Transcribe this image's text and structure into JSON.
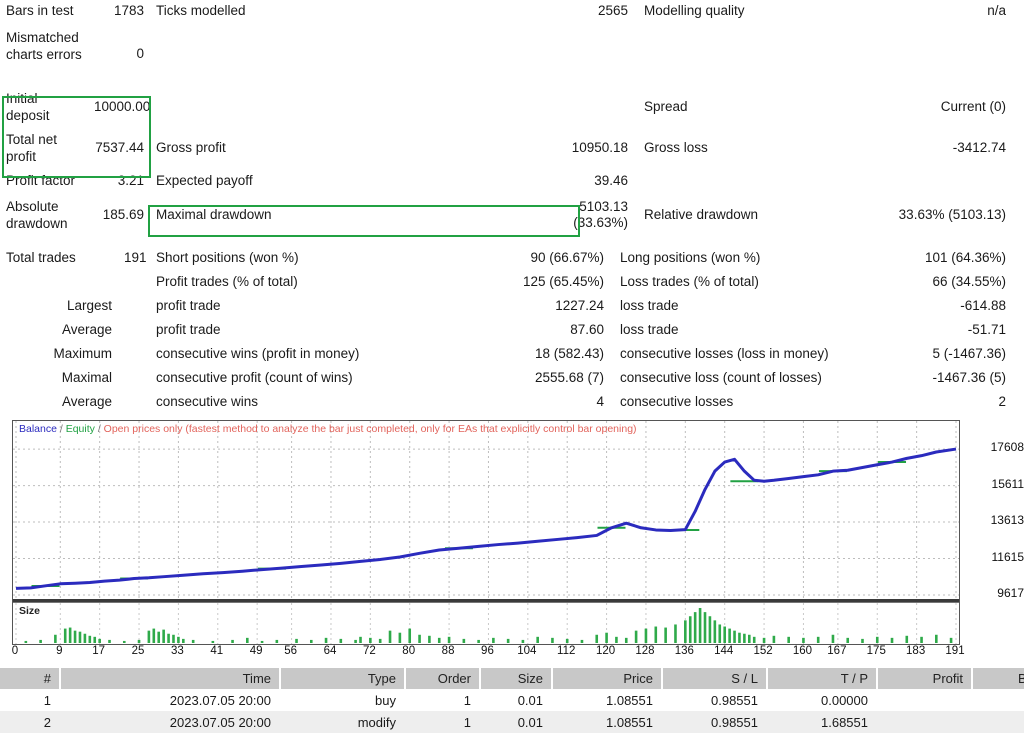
{
  "summary": {
    "rows": [
      {
        "l1": "Bars in test",
        "v1": "1783",
        "l2": "Ticks modelled",
        "v2": "2565",
        "l3": "Modelling quality",
        "v3": "n/a"
      },
      {
        "l1": "Mismatched charts errors",
        "v1": "0",
        "l2": "",
        "v2": "",
        "l3": "",
        "v3": ""
      },
      {
        "l1": "Initial deposit",
        "v1": "10000.00",
        "l2": "",
        "v2": "",
        "l3": "Spread",
        "v3": "Current (0)"
      },
      {
        "l1": "Total net profit",
        "v1": "7537.44",
        "l2": "Gross profit",
        "v2": "10950.18",
        "l3": "Gross loss",
        "v3": "-3412.74"
      },
      {
        "l1": "Profit factor",
        "v1": "3.21",
        "l2": "Expected payoff",
        "v2": "39.46",
        "l3": "",
        "v3": ""
      },
      {
        "l1": "Absolute drawdown",
        "v1": "185.69",
        "l2": "Maximal drawdown",
        "v2": "5103.13 (33.63%)",
        "l3": "Relative drawdown",
        "v3": "33.63% (5103.13)"
      }
    ],
    "trade_rows": [
      {
        "l1": "Total trades",
        "v1": "191",
        "l2": "Short positions (won %)",
        "v2": "90 (66.67%)",
        "l3": "Long positions (won %)",
        "v3": "101 (64.36%)"
      },
      {
        "l1": "",
        "v1": "",
        "l2": "Profit trades (% of total)",
        "v2": "125 (65.45%)",
        "l3": "Loss trades (% of total)",
        "v3": "66 (34.55%)"
      },
      {
        "l1": "Largest",
        "v1": "",
        "l2": "profit trade",
        "v2": "1227.24",
        "l3": "loss trade",
        "v3": "-614.88"
      },
      {
        "l1": "Average",
        "v1": "",
        "l2": "profit trade",
        "v2": "87.60",
        "l3": "loss trade",
        "v3": "-51.71"
      },
      {
        "l1": "Maximum",
        "v1": "",
        "l2": "consecutive wins (profit in money)",
        "v2": "18 (582.43)",
        "l3": "consecutive losses (loss in money)",
        "v3": "5 (-1467.36)"
      },
      {
        "l1": "Maximal",
        "v1": "",
        "l2": "consecutive profit (count of wins)",
        "v2": "2555.68 (7)",
        "l3": "consecutive loss (count of losses)",
        "v3": "-1467.36 (5)"
      },
      {
        "l1": "Average",
        "v1": "",
        "l2": "consecutive wins",
        "v2": "4",
        "l3": "consecutive losses",
        "v3": "2"
      }
    ]
  },
  "highlight_color": "#21a143",
  "chart_data": {
    "type": "line",
    "title": "",
    "legend": {
      "balance": "Balance",
      "separator": "/",
      "equity": "Equity",
      "note": "Open prices only (fastest method to analyze the bar just completed, only for EAs that explicitly control bar opening)",
      "position": "top-left"
    },
    "colors": {
      "balance": "#2b2bbe",
      "equity": "#21a143",
      "note": "#e2645c",
      "size_bars": "#2faa4a"
    },
    "xlabel": "",
    "ylabel": "",
    "ylim": [
      9617,
      18600
    ],
    "yticks": [
      17608,
      15611,
      13613,
      11615,
      9617
    ],
    "xticks": [
      0,
      9,
      17,
      25,
      33,
      41,
      49,
      56,
      64,
      72,
      80,
      88,
      96,
      104,
      112,
      120,
      128,
      136,
      144,
      152,
      160,
      167,
      175,
      183,
      191
    ],
    "grid": true,
    "series": [
      {
        "name": "Balance",
        "x": [
          0,
          3,
          6,
          9,
          12,
          15,
          18,
          21,
          24,
          27,
          30,
          34,
          38,
          42,
          46,
          50,
          54,
          58,
          62,
          66,
          70,
          74,
          78,
          82,
          86,
          90,
          94,
          98,
          102,
          106,
          110,
          114,
          118,
          121,
          124,
          127,
          130,
          133,
          136,
          138,
          140,
          142,
          144,
          146,
          148,
          150,
          152,
          154,
          157,
          160,
          163,
          166,
          169,
          172,
          175,
          178,
          181,
          184,
          187,
          191
        ],
        "values": [
          9980,
          10010,
          10120,
          10230,
          10260,
          10300,
          10380,
          10430,
          10520,
          10560,
          10620,
          10700,
          10780,
          10840,
          10920,
          11010,
          11090,
          11180,
          11260,
          11350,
          11460,
          11560,
          11700,
          11900,
          12080,
          12180,
          12280,
          12380,
          12460,
          12560,
          12660,
          12760,
          12880,
          13300,
          13550,
          13300,
          13180,
          13150,
          13200,
          14200,
          15400,
          16400,
          16900,
          17050,
          16400,
          15900,
          15850,
          15900,
          16000,
          16100,
          16200,
          16400,
          16450,
          16600,
          16750,
          16900,
          17100,
          17250,
          17450,
          17610
        ]
      },
      {
        "name": "Equity",
        "x": [
          6,
          24,
          52,
          90,
          121,
          136,
          148,
          166,
          178
        ],
        "values": [
          10110,
          10520,
          11060,
          12180,
          13300,
          13180,
          15850,
          16400,
          16900
        ]
      }
    ],
    "size_panel": {
      "label": "Size",
      "type": "bar",
      "x": [
        2,
        5,
        8,
        10,
        11,
        12,
        13,
        14,
        15,
        16,
        17,
        19,
        22,
        25,
        27,
        28,
        29,
        30,
        31,
        32,
        33,
        34,
        36,
        40,
        44,
        47,
        50,
        53,
        57,
        60,
        63,
        66,
        69,
        70,
        72,
        74,
        76,
        78,
        80,
        82,
        84,
        86,
        88,
        91,
        94,
        97,
        100,
        103,
        106,
        109,
        112,
        115,
        118,
        120,
        122,
        124,
        126,
        128,
        130,
        132,
        134,
        136,
        137,
        138,
        139,
        140,
        141,
        142,
        143,
        144,
        145,
        146,
        147,
        148,
        149,
        150,
        152,
        154,
        157,
        160,
        163,
        166,
        169,
        172,
        175,
        178,
        181,
        184,
        187,
        190
      ],
      "values": [
        2,
        3,
        8,
        14,
        15,
        12,
        11,
        9,
        7,
        6,
        4,
        3,
        2,
        3,
        12,
        14,
        11,
        13,
        9,
        8,
        6,
        4,
        3,
        2,
        3,
        5,
        2,
        3,
        4,
        3,
        5,
        4,
        3,
        6,
        5,
        4,
        12,
        10,
        14,
        8,
        7,
        5,
        6,
        4,
        3,
        5,
        4,
        3,
        6,
        5,
        4,
        3,
        8,
        10,
        6,
        5,
        12,
        14,
        16,
        15,
        18,
        22,
        26,
        30,
        34,
        30,
        26,
        22,
        18,
        16,
        14,
        12,
        10,
        9,
        8,
        6,
        5,
        7,
        6,
        5,
        6,
        8,
        5,
        4,
        6,
        5,
        7,
        6,
        8,
        5
      ]
    }
  },
  "trades_table": {
    "columns": [
      "#",
      "Time",
      "Type",
      "Order",
      "Size",
      "Price",
      "S / L",
      "T / P",
      "Profit",
      "Balance"
    ],
    "rows": [
      {
        "n": "1",
        "time": "2023.07.05 20:00",
        "type": "buy",
        "order": "1",
        "size": "0.01",
        "price": "1.08551",
        "sl": "0.98551",
        "tp": "0.00000",
        "profit": "",
        "balance": ""
      },
      {
        "n": "2",
        "time": "2023.07.05 20:00",
        "type": "modify",
        "order": "1",
        "size": "0.01",
        "price": "1.08551",
        "sl": "0.98551",
        "tp": "1.68551",
        "profit": "",
        "balance": ""
      }
    ]
  }
}
